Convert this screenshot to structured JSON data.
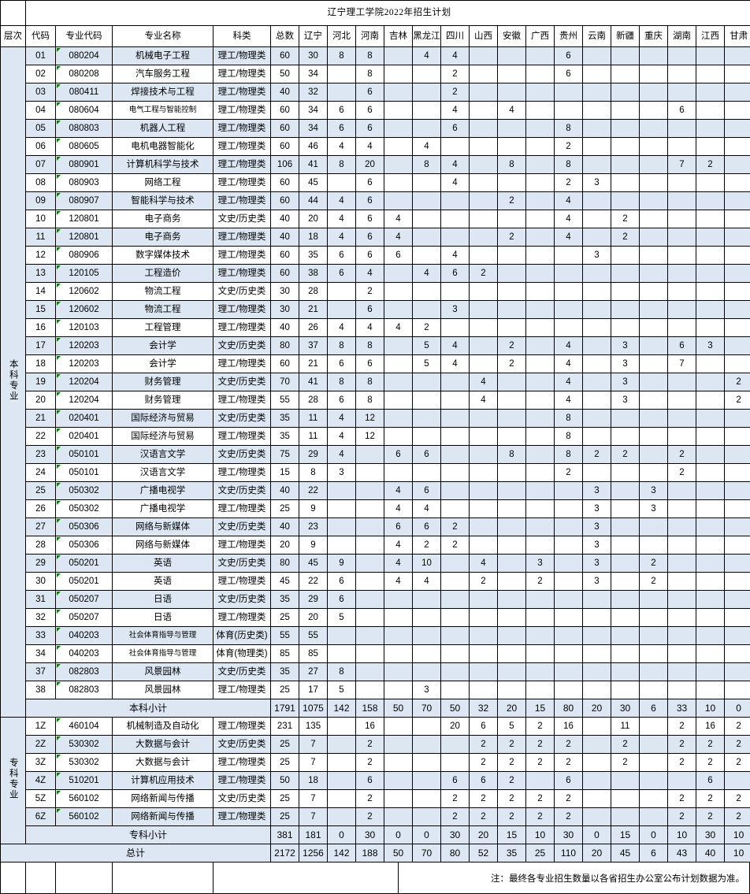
{
  "title": "辽宁理工学院2022年招生计划",
  "columns": [
    {
      "key": "level",
      "label": "层次"
    },
    {
      "key": "no",
      "label": "代码"
    },
    {
      "key": "major_code",
      "label": "专业代码"
    },
    {
      "key": "major_name",
      "label": "专业名称"
    },
    {
      "key": "kind",
      "label": "科类"
    },
    {
      "key": "total",
      "label": "总数"
    },
    {
      "key": "liaoning",
      "label": "辽宁"
    },
    {
      "key": "hebei",
      "label": "河北"
    },
    {
      "key": "henan",
      "label": "河南"
    },
    {
      "key": "jilin",
      "label": "吉林"
    },
    {
      "key": "heilongjiang",
      "label": "黑龙江"
    },
    {
      "key": "sichuan",
      "label": "四川"
    },
    {
      "key": "shanxi",
      "label": "山西"
    },
    {
      "key": "anhui",
      "label": "安徽"
    },
    {
      "key": "guangxi",
      "label": "广西"
    },
    {
      "key": "guizhou",
      "label": "贵州"
    },
    {
      "key": "yunnan",
      "label": "云南"
    },
    {
      "key": "xinjiang",
      "label": "新疆"
    },
    {
      "key": "chongqing",
      "label": "重庆"
    },
    {
      "key": "hunan",
      "label": "湖南"
    },
    {
      "key": "jiangxi",
      "label": "江西"
    },
    {
      "key": "gansu",
      "label": "甘肃"
    }
  ],
  "groups": {
    "undergraduate_label": "本科专业",
    "college_label": "专科专业",
    "undergraduate_subtotal_label": "本科小计",
    "college_subtotal_label": "专科小计",
    "grand_total_label": "总计"
  },
  "kinds": {
    "science": "理工/物理类",
    "arts": "文史/历史类",
    "pe_history": "体育(历史类)",
    "pe_physics": "体育(物理类)"
  },
  "undergraduate_rows": [
    {
      "no": "01",
      "major_code": "080204",
      "major_name": "机械电子工程",
      "kind": "理工/物理类",
      "cells": [
        "60",
        "30",
        "8",
        "8",
        "",
        "4",
        "4",
        "",
        "",
        "",
        "6",
        "",
        "",
        "",
        "",
        "",
        ""
      ]
    },
    {
      "no": "02",
      "major_code": "080208",
      "major_name": "汽车服务工程",
      "kind": "理工/物理类",
      "cells": [
        "50",
        "34",
        "",
        "8",
        "",
        "",
        "2",
        "",
        "",
        "",
        "6",
        "",
        "",
        "",
        "",
        "",
        ""
      ]
    },
    {
      "no": "03",
      "major_code": "080411",
      "major_name": "焊接技术与工程",
      "kind": "理工/物理类",
      "cells": [
        "40",
        "32",
        "",
        "6",
        "",
        "",
        "2",
        "",
        "",
        "",
        "",
        "",
        "",
        "",
        "",
        "",
        ""
      ]
    },
    {
      "no": "04",
      "major_code": "080604",
      "major_name": "电气工程与智能控制",
      "kind": "理工/物理类",
      "small": true,
      "cells": [
        "60",
        "34",
        "6",
        "6",
        "",
        "",
        "4",
        "",
        "4",
        "",
        "",
        "",
        "",
        "",
        "6",
        "",
        ""
      ]
    },
    {
      "no": "05",
      "major_code": "080803",
      "major_name": "机器人工程",
      "kind": "理工/物理类",
      "cells": [
        "60",
        "34",
        "6",
        "6",
        "",
        "",
        "6",
        "",
        "",
        "",
        "8",
        "",
        "",
        "",
        "",
        "",
        ""
      ]
    },
    {
      "no": "06",
      "major_code": "080605",
      "major_name": "电机电器智能化",
      "kind": "理工/物理类",
      "cells": [
        "60",
        "46",
        "4",
        "4",
        "",
        "4",
        "",
        "",
        "",
        "",
        "2",
        "",
        "",
        "",
        "",
        "",
        ""
      ]
    },
    {
      "no": "07",
      "major_code": "080901",
      "major_name": "计算机科学与技术",
      "kind": "理工/物理类",
      "cells": [
        "106",
        "41",
        "8",
        "20",
        "",
        "8",
        "4",
        "",
        "8",
        "",
        "8",
        "",
        "",
        "",
        "7",
        "2",
        ""
      ]
    },
    {
      "no": "08",
      "major_code": "080903",
      "major_name": "网络工程",
      "kind": "理工/物理类",
      "cells": [
        "60",
        "45",
        "",
        "6",
        "",
        "",
        "4",
        "",
        "",
        "",
        "2",
        "3",
        "",
        "",
        "",
        "",
        ""
      ]
    },
    {
      "no": "09",
      "major_code": "080907",
      "major_name": "智能科学与技术",
      "kind": "理工/物理类",
      "cells": [
        "60",
        "44",
        "4",
        "6",
        "",
        "",
        "",
        "",
        "2",
        "",
        "4",
        "",
        "",
        "",
        "",
        "",
        ""
      ]
    },
    {
      "no": "10",
      "major_code": "120801",
      "major_name": "电子商务",
      "kind": "文史/历史类",
      "cells": [
        "40",
        "20",
        "4",
        "6",
        "4",
        "",
        "",
        "",
        "",
        "",
        "4",
        "",
        "2",
        "",
        "",
        "",
        ""
      ]
    },
    {
      "no": "11",
      "major_code": "120801",
      "major_name": "电子商务",
      "kind": "理工/物理类",
      "cells": [
        "40",
        "18",
        "4",
        "6",
        "4",
        "",
        "",
        "",
        "2",
        "",
        "4",
        "",
        "2",
        "",
        "",
        "",
        ""
      ]
    },
    {
      "no": "12",
      "major_code": "080906",
      "major_name": "数字媒体技术",
      "kind": "理工/物理类",
      "cells": [
        "60",
        "35",
        "6",
        "6",
        "6",
        "",
        "4",
        "",
        "",
        "",
        "",
        "3",
        "",
        "",
        "",
        "",
        ""
      ]
    },
    {
      "no": "13",
      "major_code": "120105",
      "major_name": "工程造价",
      "kind": "理工/物理类",
      "cells": [
        "60",
        "38",
        "6",
        "4",
        "",
        "4",
        "6",
        "2",
        "",
        "",
        "",
        "",
        "",
        "",
        "",
        "",
        ""
      ]
    },
    {
      "no": "14",
      "major_code": "120602",
      "major_name": "物流工程",
      "kind": "文史/历史类",
      "cells": [
        "30",
        "28",
        "",
        "2",
        "",
        "",
        "",
        "",
        "",
        "",
        "",
        "",
        "",
        "",
        "",
        "",
        ""
      ]
    },
    {
      "no": "15",
      "major_code": "120602",
      "major_name": "物流工程",
      "kind": "理工/物理类",
      "cells": [
        "30",
        "21",
        "",
        "6",
        "",
        "",
        "3",
        "",
        "",
        "",
        "",
        "",
        "",
        "",
        "",
        "",
        ""
      ]
    },
    {
      "no": "16",
      "major_code": "120103",
      "major_name": "工程管理",
      "kind": "理工/物理类",
      "cells": [
        "40",
        "26",
        "4",
        "4",
        "4",
        "2",
        "",
        "",
        "",
        "",
        "",
        "",
        "",
        "",
        "",
        "",
        ""
      ]
    },
    {
      "no": "17",
      "major_code": "120203",
      "major_name": "会计学",
      "kind": "文史/历史类",
      "cells": [
        "80",
        "37",
        "8",
        "8",
        "",
        "5",
        "4",
        "",
        "2",
        "",
        "4",
        "",
        "3",
        "",
        "6",
        "3",
        ""
      ]
    },
    {
      "no": "18",
      "major_code": "120203",
      "major_name": "会计学",
      "kind": "理工/物理类",
      "cells": [
        "60",
        "21",
        "6",
        "6",
        "",
        "5",
        "4",
        "",
        "2",
        "",
        "4",
        "",
        "3",
        "",
        "7",
        ""
      ]
    },
    {
      "no": "19",
      "major_code": "120204",
      "major_name": "财务管理",
      "kind": "文史/历史类",
      "cells": [
        "70",
        "41",
        "8",
        "8",
        "",
        "",
        "",
        "4",
        "",
        "",
        "4",
        "",
        "3",
        "",
        "",
        "",
        "2"
      ]
    },
    {
      "no": "20",
      "major_code": "120204",
      "major_name": "财务管理",
      "kind": "理工/物理类",
      "cells": [
        "55",
        "28",
        "6",
        "8",
        "",
        "",
        "",
        "4",
        "",
        "",
        "4",
        "",
        "3",
        "",
        "",
        "",
        "2"
      ]
    },
    {
      "no": "21",
      "major_code": "020401",
      "major_name": "国际经济与贸易",
      "kind": "文史/历史类",
      "cells": [
        "35",
        "11",
        "4",
        "12",
        "",
        "",
        "",
        "",
        "",
        "",
        "8",
        "",
        "",
        "",
        "",
        "",
        ""
      ]
    },
    {
      "no": "22",
      "major_code": "020401",
      "major_name": "国际经济与贸易",
      "kind": "理工/物理类",
      "cells": [
        "35",
        "11",
        "4",
        "12",
        "",
        "",
        "",
        "",
        "",
        "",
        "8",
        "",
        "",
        "",
        "",
        "",
        ""
      ]
    },
    {
      "no": "23",
      "major_code": "050101",
      "major_name": "汉语言文学",
      "kind": "文史/历史类",
      "cells": [
        "75",
        "29",
        "4",
        "",
        "6",
        "6",
        "",
        "",
        "8",
        "",
        "8",
        "2",
        "2",
        "",
        "2",
        "",
        ""
      ]
    },
    {
      "no": "24",
      "major_code": "050101",
      "major_name": "汉语言文学",
      "kind": "理工/物理类",
      "cells": [
        "15",
        "8",
        "3",
        "",
        "",
        "",
        "",
        "",
        "",
        "",
        "2",
        "",
        "",
        "",
        "2",
        "",
        ""
      ]
    },
    {
      "no": "25",
      "major_code": "050302",
      "major_name": "广播电视学",
      "kind": "文史/历史类",
      "cells": [
        "40",
        "22",
        "",
        "",
        "4",
        "6",
        "",
        "",
        "",
        "",
        "",
        "3",
        "",
        "3",
        "",
        "",
        ""
      ]
    },
    {
      "no": "26",
      "major_code": "050302",
      "major_name": "广播电视学",
      "kind": "理工/物理类",
      "cells": [
        "25",
        "9",
        "",
        "",
        "4",
        "4",
        "",
        "",
        "",
        "",
        "",
        "3",
        "",
        "3",
        "",
        "",
        ""
      ]
    },
    {
      "no": "27",
      "major_code": "050306",
      "major_name": "网络与新媒体",
      "kind": "文史/历史类",
      "cells": [
        "40",
        "23",
        "",
        "",
        "6",
        "6",
        "2",
        "",
        "",
        "",
        "",
        "3",
        "",
        "",
        "",
        "",
        ""
      ]
    },
    {
      "no": "28",
      "major_code": "050306",
      "major_name": "网络与新媒体",
      "kind": "理工/物理类",
      "cells": [
        "20",
        "9",
        "",
        "",
        "4",
        "2",
        "2",
        "",
        "",
        "",
        "",
        "3",
        "",
        "",
        "",
        "",
        ""
      ]
    },
    {
      "no": "29",
      "major_code": "050201",
      "major_name": "英语",
      "kind": "文史/历史类",
      "cells": [
        "80",
        "45",
        "9",
        "",
        "4",
        "10",
        "",
        "4",
        "",
        "3",
        "",
        "3",
        "",
        "2",
        "",
        "",
        ""
      ]
    },
    {
      "no": "30",
      "major_code": "050201",
      "major_name": "英语",
      "kind": "理工/物理类",
      "cells": [
        "45",
        "22",
        "6",
        "",
        "4",
        "4",
        "",
        "2",
        "",
        "2",
        "",
        "3",
        "",
        "2",
        "",
        "",
        ""
      ]
    },
    {
      "no": "31",
      "major_code": "050207",
      "major_name": "日语",
      "kind": "文史/历史类",
      "cells": [
        "35",
        "29",
        "6",
        "",
        "",
        "",
        "",
        "",
        "",
        "",
        "",
        "",
        "",
        "",
        "",
        "",
        ""
      ]
    },
    {
      "no": "32",
      "major_code": "050207",
      "major_name": "日语",
      "kind": "理工/物理类",
      "cells": [
        "25",
        "20",
        "5",
        "",
        "",
        "",
        "",
        "",
        "",
        "",
        "",
        "",
        "",
        "",
        "",
        "",
        ""
      ]
    },
    {
      "no": "33",
      "major_code": "040203",
      "major_name": "社会体育指导与管理",
      "kind": "体育(历史类)",
      "small": true,
      "cells": [
        "55",
        "55",
        "",
        "",
        "",
        "",
        "",
        "",
        "",
        "",
        "",
        "",
        "",
        "",
        "",
        "",
        ""
      ]
    },
    {
      "no": "34",
      "major_code": "040203",
      "major_name": "社会体育指导与管理",
      "kind": "体育(物理类)",
      "small": true,
      "cells": [
        "85",
        "85",
        "",
        "",
        "",
        "",
        "",
        "",
        "",
        "",
        "",
        "",
        "",
        "",
        "",
        "",
        ""
      ]
    },
    {
      "no": "37",
      "major_code": "082803",
      "major_name": "风景园林",
      "kind": "文史/历史类",
      "cells": [
        "35",
        "27",
        "8",
        "",
        "",
        "",
        "",
        "",
        "",
        "",
        "",
        "",
        "",
        "",
        "",
        "",
        ""
      ]
    },
    {
      "no": "38",
      "major_code": "082803",
      "major_name": "风景园林",
      "kind": "理工/物理类",
      "cells": [
        "25",
        "17",
        "5",
        "",
        "",
        "3",
        "",
        "",
        "",
        "",
        "",
        "",
        "",
        "",
        "",
        "",
        ""
      ]
    }
  ],
  "undergraduate_subtotal": [
    "1791",
    "1075",
    "142",
    "158",
    "50",
    "70",
    "50",
    "32",
    "20",
    "15",
    "80",
    "20",
    "30",
    "6",
    "33",
    "10",
    "0"
  ],
  "college_rows": [
    {
      "no": "1Z",
      "major_code": "460104",
      "major_name": "机械制造及自动化",
      "kind": "理工/物理类",
      "cells": [
        "231",
        "135",
        "",
        "16",
        "",
        "",
        "20",
        "6",
        "5",
        "2",
        "16",
        "",
        "11",
        "",
        "2",
        "16",
        "2"
      ]
    },
    {
      "no": "2Z",
      "major_code": "530302",
      "major_name": "大数据与会计",
      "kind": "文史/历史类",
      "cells": [
        "25",
        "7",
        "",
        "2",
        "",
        "",
        "",
        "2",
        "2",
        "2",
        "2",
        "",
        "2",
        "",
        "2",
        "2",
        "2"
      ]
    },
    {
      "no": "3Z",
      "major_code": "530302",
      "major_name": "大数据与会计",
      "kind": "理工/物理类",
      "cells": [
        "25",
        "7",
        "",
        "2",
        "",
        "",
        "",
        "2",
        "2",
        "2",
        "2",
        "",
        "2",
        "",
        "2",
        "2",
        "2"
      ]
    },
    {
      "no": "4Z",
      "major_code": "510201",
      "major_name": "计算机应用技术",
      "kind": "理工/物理类",
      "cells": [
        "50",
        "18",
        "",
        "6",
        "",
        "",
        "6",
        "6",
        "2",
        "",
        "6",
        "",
        "",
        "",
        "",
        "6",
        ""
      ]
    },
    {
      "no": "5Z",
      "major_code": "560102",
      "major_name": "网络新闻与传播",
      "kind": "文史/历史类",
      "cells": [
        "25",
        "7",
        "",
        "2",
        "",
        "",
        "2",
        "2",
        "2",
        "2",
        "2",
        "",
        "",
        "",
        "2",
        "2",
        "2"
      ]
    },
    {
      "no": "6Z",
      "major_code": "560102",
      "major_name": "网络新闻与传播",
      "kind": "理工/物理类",
      "cells": [
        "25",
        "7",
        "",
        "2",
        "",
        "",
        "2",
        "2",
        "2",
        "2",
        "2",
        "",
        "",
        "",
        "2",
        "2",
        "2"
      ]
    }
  ],
  "college_subtotal": [
    "381",
    "181",
    "0",
    "30",
    "0",
    "0",
    "30",
    "20",
    "15",
    "10",
    "30",
    "0",
    "15",
    "0",
    "10",
    "30",
    "10"
  ],
  "grand_total": [
    "2172",
    "1256",
    "142",
    "188",
    "50",
    "70",
    "80",
    "52",
    "35",
    "25",
    "110",
    "20",
    "45",
    "6",
    "43",
    "40",
    "10"
  ],
  "note": "注：最终各专业招生数量以各省招生办公室公布计划数据为准。"
}
